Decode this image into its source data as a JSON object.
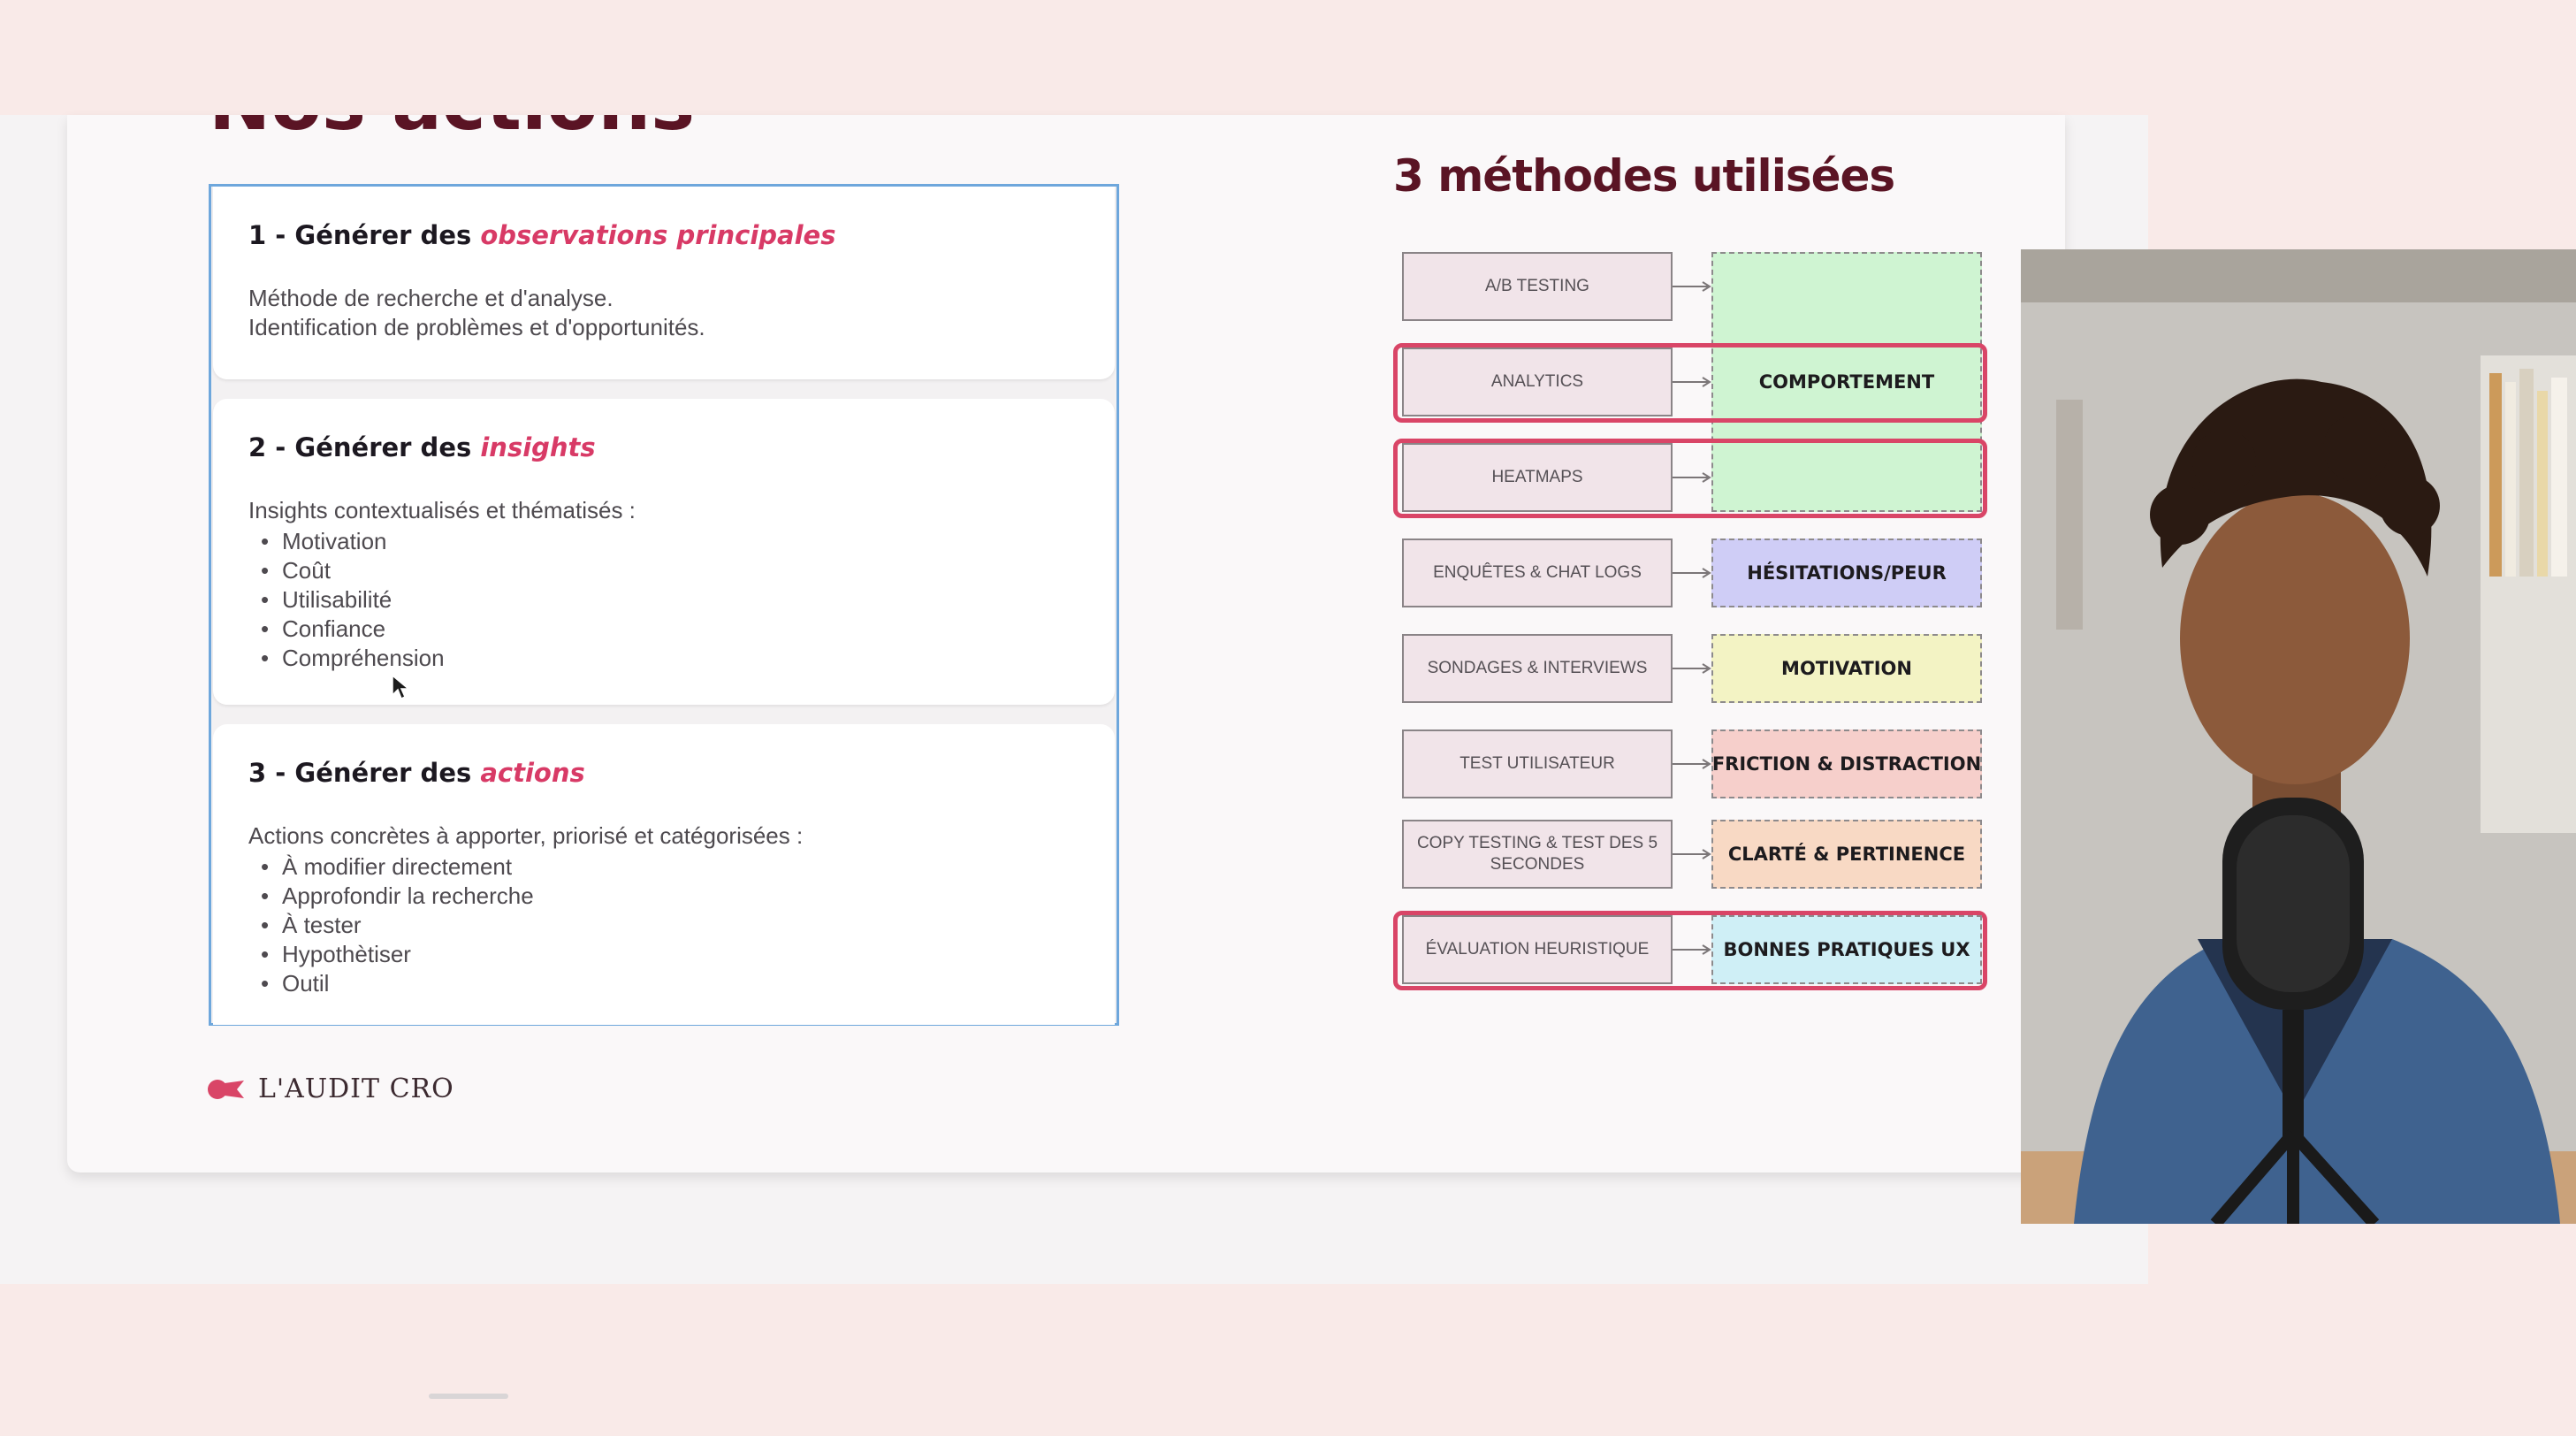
{
  "slide": {
    "cut_title": "Nos actions",
    "steps": [
      {
        "number_prefix": "1 - Générer des ",
        "highlight": "observations principales",
        "lines": [
          "Méthode de recherche et d'analyse.",
          "Identification de problèmes et d'opportunités."
        ],
        "bullets": []
      },
      {
        "number_prefix": "2 - Générer des ",
        "highlight": "insights",
        "lines": [
          "Insights contextualisés et thématisés :"
        ],
        "bullets": [
          "Motivation",
          "Coût",
          "Utilisabilité",
          "Confiance",
          "Compréhension"
        ]
      },
      {
        "number_prefix": "3 - Générer des ",
        "highlight": "actions",
        "lines": [
          "Actions concrètes à apporter, priorisé et catégorisées :"
        ],
        "bullets": [
          "À modifier directement",
          "Approfondir la recherche",
          "À tester",
          "Hypothètiser",
          "Outil"
        ]
      }
    ],
    "brand": "L'AUDIT CRO",
    "methods_title": "3 méthodes utilisées",
    "methods": [
      {
        "method": "A/B TESTING",
        "result": "",
        "result_color": "#cff4d2",
        "highlighted": false
      },
      {
        "method": "ANALYTICS",
        "result": "COMPORTEMENT",
        "result_color": "#cff4d2",
        "highlighted": true
      },
      {
        "method": "HEATMAPS",
        "result": "",
        "result_color": "#cff4d2",
        "highlighted": true
      },
      {
        "method": "ENQUÊTES & CHAT LOGS",
        "result": "HÉSITATIONS/PEUR",
        "result_color": "#cfcdf6",
        "highlighted": false
      },
      {
        "method": "SONDAGES & INTERVIEWS",
        "result": "MOTIVATION",
        "result_color": "#f3f3c4",
        "highlighted": false
      },
      {
        "method": "TEST UTILISATEUR",
        "result": "FRICTION & DISTRACTION",
        "result_color": "#f6cfcb",
        "highlighted": false
      },
      {
        "method": "COPY TESTING & TEST DES 5 SECONDES",
        "result": "CLARTÉ & PERTINENCE",
        "result_color": "#f8d9c4",
        "highlighted": false
      },
      {
        "method": "ÉVALUATION HEURISTIQUE",
        "result": "BONNES PRATIQUES UX",
        "result_color": "#cfeff6",
        "highlighted": true
      }
    ]
  },
  "colors": {
    "accent_pink": "#d83a66",
    "title_maroon": "#5a1424",
    "panel_border": "#6ea7dc",
    "page_background": "#f9eae8"
  },
  "icons": {
    "cursor": "mouse-cursor-icon",
    "brand_mark": "brand-logo-icon",
    "arrow": "arrow-right-icon"
  }
}
